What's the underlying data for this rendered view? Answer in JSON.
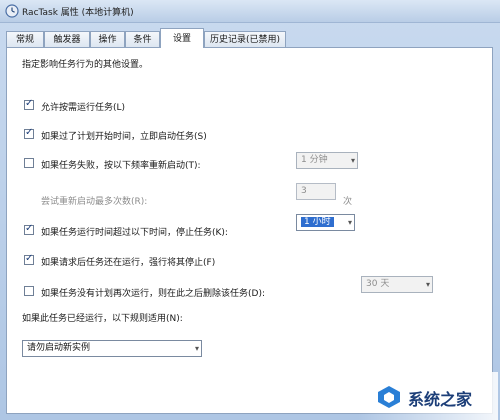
{
  "window": {
    "title": "RacTask 属性 (本地计算机)"
  },
  "tabs": [
    {
      "label": "常规"
    },
    {
      "label": "触发器"
    },
    {
      "label": "操作"
    },
    {
      "label": "条件"
    },
    {
      "label": "设置"
    },
    {
      "label": "历史记录(已禁用)"
    }
  ],
  "settings": {
    "description": "指定影响任务行为的其他设置。",
    "allow_on_demand": {
      "label": "允许按需运行任务(L)",
      "checked": true
    },
    "run_missed": {
      "label": "如果过了计划开始时间，立即启动任务(S)",
      "checked": true
    },
    "restart_on_fail": {
      "label": "如果任务失败，按以下频率重新启动(T):",
      "checked": false,
      "interval": "1 分钟"
    },
    "restart_attempts": {
      "label": "尝试重新启动最多次数(R):",
      "value": "3",
      "unit": "次"
    },
    "stop_if_longer": {
      "label": "如果任务运行时间超过以下时间，停止任务(K):",
      "checked": true,
      "duration": "1 小时"
    },
    "force_stop": {
      "label": "如果请求后任务还在运行，强行将其停止(F)",
      "checked": true
    },
    "delete_if_not_scheduled": {
      "label": "如果任务没有计划再次运行，则在此之后删除该任务(D):",
      "checked": false,
      "after": "30 天"
    },
    "rule_label": "如果此任务已经运行，以下规则适用(N):",
    "rule_value": "请勿启动新实例"
  },
  "watermark": {
    "text": "系统之家"
  },
  "icons": {
    "check": "✓",
    "dropdown": "▾",
    "app": "clock-icon"
  }
}
